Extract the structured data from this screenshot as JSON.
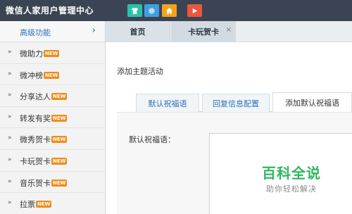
{
  "app": {
    "title": "微信人家用户管理中心"
  },
  "toolbar": {
    "buttons": [
      {
        "icon": "shirt-icon",
        "color": "#29c2a8"
      },
      {
        "icon": "gear-icon",
        "color": "#3e9fe0"
      },
      {
        "icon": "home-icon",
        "color": "#f4a31b"
      },
      {
        "icon": "play-icon",
        "color": "#e9573f"
      }
    ]
  },
  "sidebar": {
    "header": {
      "label": "高级功能",
      "chevron": "›"
    },
    "items": [
      {
        "label": "微助力",
        "badge": "NEW"
      },
      {
        "label": "微冲榜",
        "badge": "NEW"
      },
      {
        "label": "分享达人",
        "badge": "NEW"
      },
      {
        "label": "转发有奖",
        "badge": "NEW"
      },
      {
        "label": "微秀贺卡",
        "badge": "NEW"
      },
      {
        "label": "卡玩贺卡",
        "badge": "NEW"
      },
      {
        "label": "音乐贺卡",
        "badge": "NEW"
      },
      {
        "label": "拉票",
        "badge": "NEW"
      }
    ],
    "arrow": "»"
  },
  "tabs": [
    {
      "label": "首页"
    },
    {
      "label": "卡玩贺卡",
      "close": "×"
    }
  ],
  "main": {
    "section_title": "添加主题活动",
    "subtabs": [
      {
        "label": "默认祝福语"
      },
      {
        "label": "回复信息配置"
      },
      {
        "label": "添加默认祝福语"
      }
    ],
    "field_label": "默认祝福语：",
    "field_value": ""
  },
  "watermark": {
    "title": "百科全说",
    "subtitle": "助你轻松解决"
  }
}
